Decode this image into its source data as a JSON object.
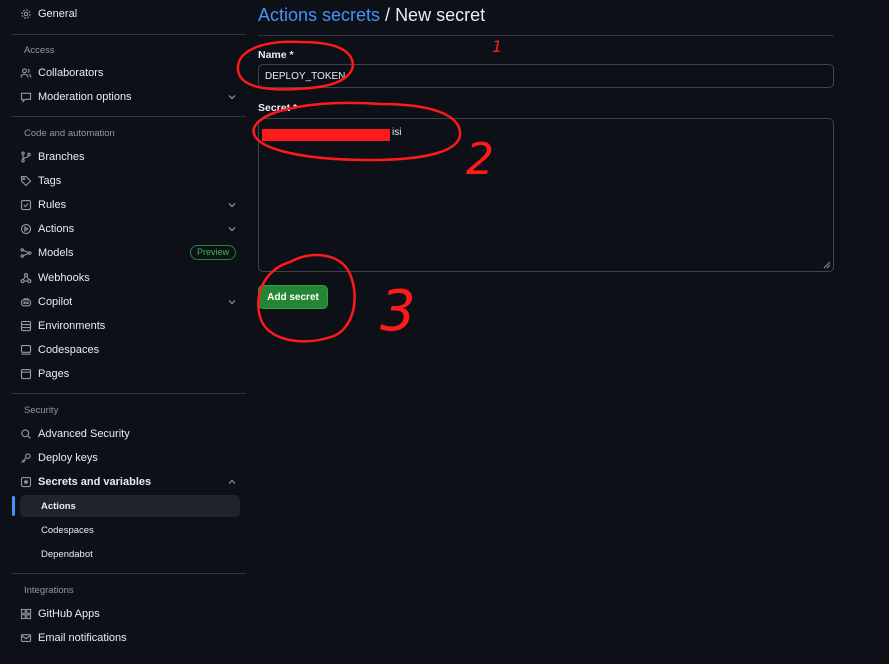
{
  "sidebar": {
    "general": "General",
    "access_header": "Access",
    "collaborators": "Collaborators",
    "moderation": "Moderation options",
    "code_header": "Code and automation",
    "branches": "Branches",
    "tags": "Tags",
    "rules": "Rules",
    "actions": "Actions",
    "models": "Models",
    "models_badge": "Preview",
    "webhooks": "Webhooks",
    "copilot": "Copilot",
    "environments": "Environments",
    "codespaces": "Codespaces",
    "pages": "Pages",
    "security_header": "Security",
    "advanced_security": "Advanced Security",
    "deploy_keys": "Deploy keys",
    "secrets_vars": "Secrets and variables",
    "sub_actions": "Actions",
    "sub_codespaces": "Codespaces",
    "sub_dependabot": "Dependabot",
    "integrations_header": "Integrations",
    "github_apps": "GitHub Apps",
    "email_notifications": "Email notifications"
  },
  "main": {
    "breadcrumb": "Actions secrets",
    "title_sep": " / ",
    "title": "New secret",
    "name_label": "Name *",
    "name_value": "DEPLOY_TOKEN",
    "secret_label": "Secret *",
    "secret_value_visible": "isi",
    "add_button": "Add secret"
  },
  "annotations": [
    "1",
    "2",
    "3"
  ],
  "colors": {
    "accent_blue": "#4493f8",
    "button_green": "#238636",
    "annotation_red": "#ff1a1a"
  }
}
